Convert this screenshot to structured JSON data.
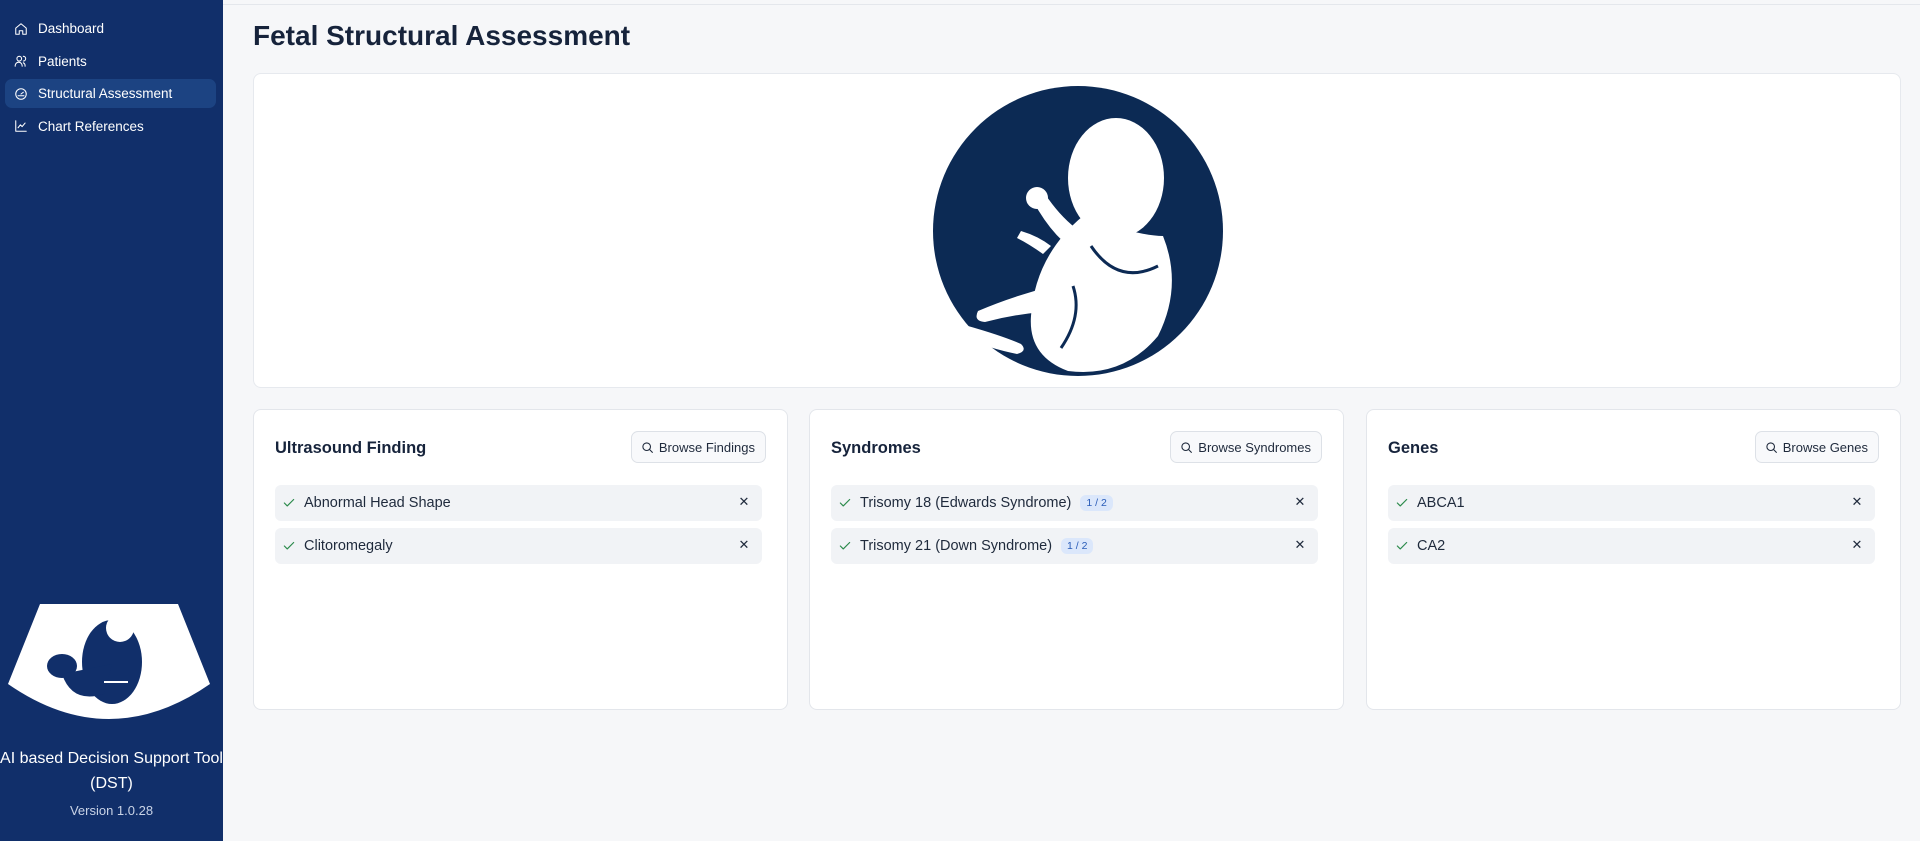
{
  "sidebar": {
    "items": [
      {
        "label": "Dashboard",
        "icon": "home-icon"
      },
      {
        "label": "Patients",
        "icon": "users-icon"
      },
      {
        "label": "Structural Assessment",
        "icon": "gauge-icon",
        "active": true
      },
      {
        "label": "Chart References",
        "icon": "line-chart-icon"
      }
    ],
    "app_name": "AI based Decision Support Tool (DST)",
    "version": "Version 1.0.28"
  },
  "page": {
    "title": "Fetal Structural Assessment"
  },
  "cards": [
    {
      "title": "Ultrasound Finding",
      "button": "Browse Findings",
      "items": [
        {
          "label": "Abnormal Head Shape"
        },
        {
          "label": "Clitoromegaly"
        }
      ]
    },
    {
      "title": "Syndromes",
      "button": "Browse Syndromes",
      "items": [
        {
          "label": "Trisomy 18 (Edwards Syndrome)",
          "badge": "1 / 2"
        },
        {
          "label": "Trisomy 21 (Down Syndrome)",
          "badge": "1 / 2"
        }
      ]
    },
    {
      "title": "Genes",
      "button": "Browse Genes",
      "items": [
        {
          "label": "ABCA1"
        },
        {
          "label": "CA2"
        }
      ]
    }
  ],
  "colors": {
    "sidebar_bg": "#112f6a",
    "sidebar_active": "#1c4382",
    "hero_circle": "#0c2a54",
    "check": "#2b8a4b",
    "badge_bg": "#dbe7fb",
    "badge_text": "#2a5cb8"
  }
}
